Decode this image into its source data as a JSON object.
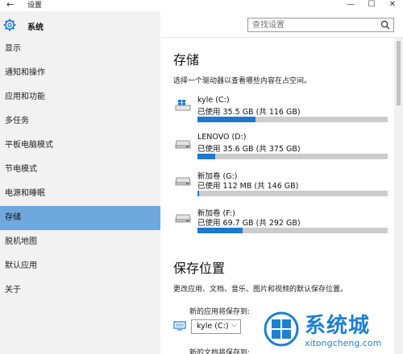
{
  "window": {
    "title": "设置",
    "back_glyph": "←",
    "min_glyph": "—",
    "max_glyph": "☐",
    "close_glyph": "✕"
  },
  "sidebar": {
    "header": "系统",
    "items": [
      {
        "label": "显示",
        "selected": false
      },
      {
        "label": "通知和操作",
        "selected": false
      },
      {
        "label": "应用和功能",
        "selected": false
      },
      {
        "label": "多任务",
        "selected": false
      },
      {
        "label": "平板电脑模式",
        "selected": false
      },
      {
        "label": "节电模式",
        "selected": false
      },
      {
        "label": "电源和睡眠",
        "selected": false
      },
      {
        "label": "存储",
        "selected": true
      },
      {
        "label": "脱机地图",
        "selected": false
      },
      {
        "label": "默认应用",
        "selected": false
      },
      {
        "label": "关于",
        "selected": false
      }
    ]
  },
  "search": {
    "placeholder": "查找设置"
  },
  "storage": {
    "title": "存储",
    "description": "选择一个驱动器以查看哪些内容在占空间。",
    "drives": [
      {
        "name": "kyle (C:)",
        "usage": "已使用 35.5 GB (共 116 GB)",
        "fraction": 0.306,
        "icon": "windows-drive-icon"
      },
      {
        "name": "LENOVO (D:)",
        "usage": "已使用 35.6 GB (共 375 GB)",
        "fraction": 0.095,
        "icon": "drive-icon"
      },
      {
        "name": "新加卷 (G:)",
        "usage": "已使用 112 MB (共 146 GB)",
        "fraction": 0.001,
        "icon": "drive-icon"
      },
      {
        "name": "新加卷 (F:)",
        "usage": "已使用 69.7 GB (共 292 GB)",
        "fraction": 0.239,
        "icon": "drive-icon"
      }
    ]
  },
  "save_locations": {
    "title": "保存位置",
    "description": "更改应用、文档、音乐、图片和视频的默认保存位置。",
    "new_apps_label": "新的应用将保存到:",
    "new_apps_value": "kyle (C:)",
    "next_label_partial": "新的文档将保存到:"
  },
  "watermark": {
    "brand": "系统城",
    "url": "xitongcheng.com"
  },
  "colors": {
    "accent": "#1e78d2",
    "selected_nav": "#6fa8dc",
    "sidebar_bg": "#f2f2f2",
    "bar_track": "#cccccc"
  }
}
